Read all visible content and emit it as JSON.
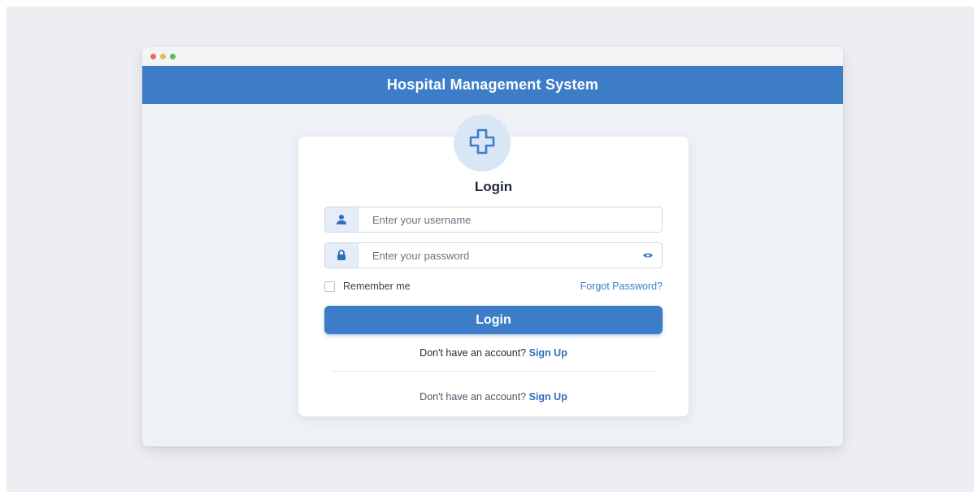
{
  "window": {
    "title": "Hospital Management System"
  },
  "login": {
    "heading": "Login",
    "username_placeholder": "Enter your username",
    "password_placeholder": "Enter your password",
    "remember_label": "Remember me",
    "forgot_label": "Forgot Password?",
    "submit_label": "Login",
    "signup_prompt_1": "Don't have an account?",
    "signup_link_1": "Sign Up",
    "signup_prompt_2": "Don't have an account?",
    "signup_link_2": "Sign Up"
  },
  "icons": {
    "logo": "medical-cross-icon",
    "username": "user-icon",
    "password": "lock-icon",
    "reveal": "eye-icon"
  },
  "colors": {
    "primary": "#3d7dc8",
    "logo_bg": "#d9e6f5",
    "window_bg": "#eef2f7"
  }
}
